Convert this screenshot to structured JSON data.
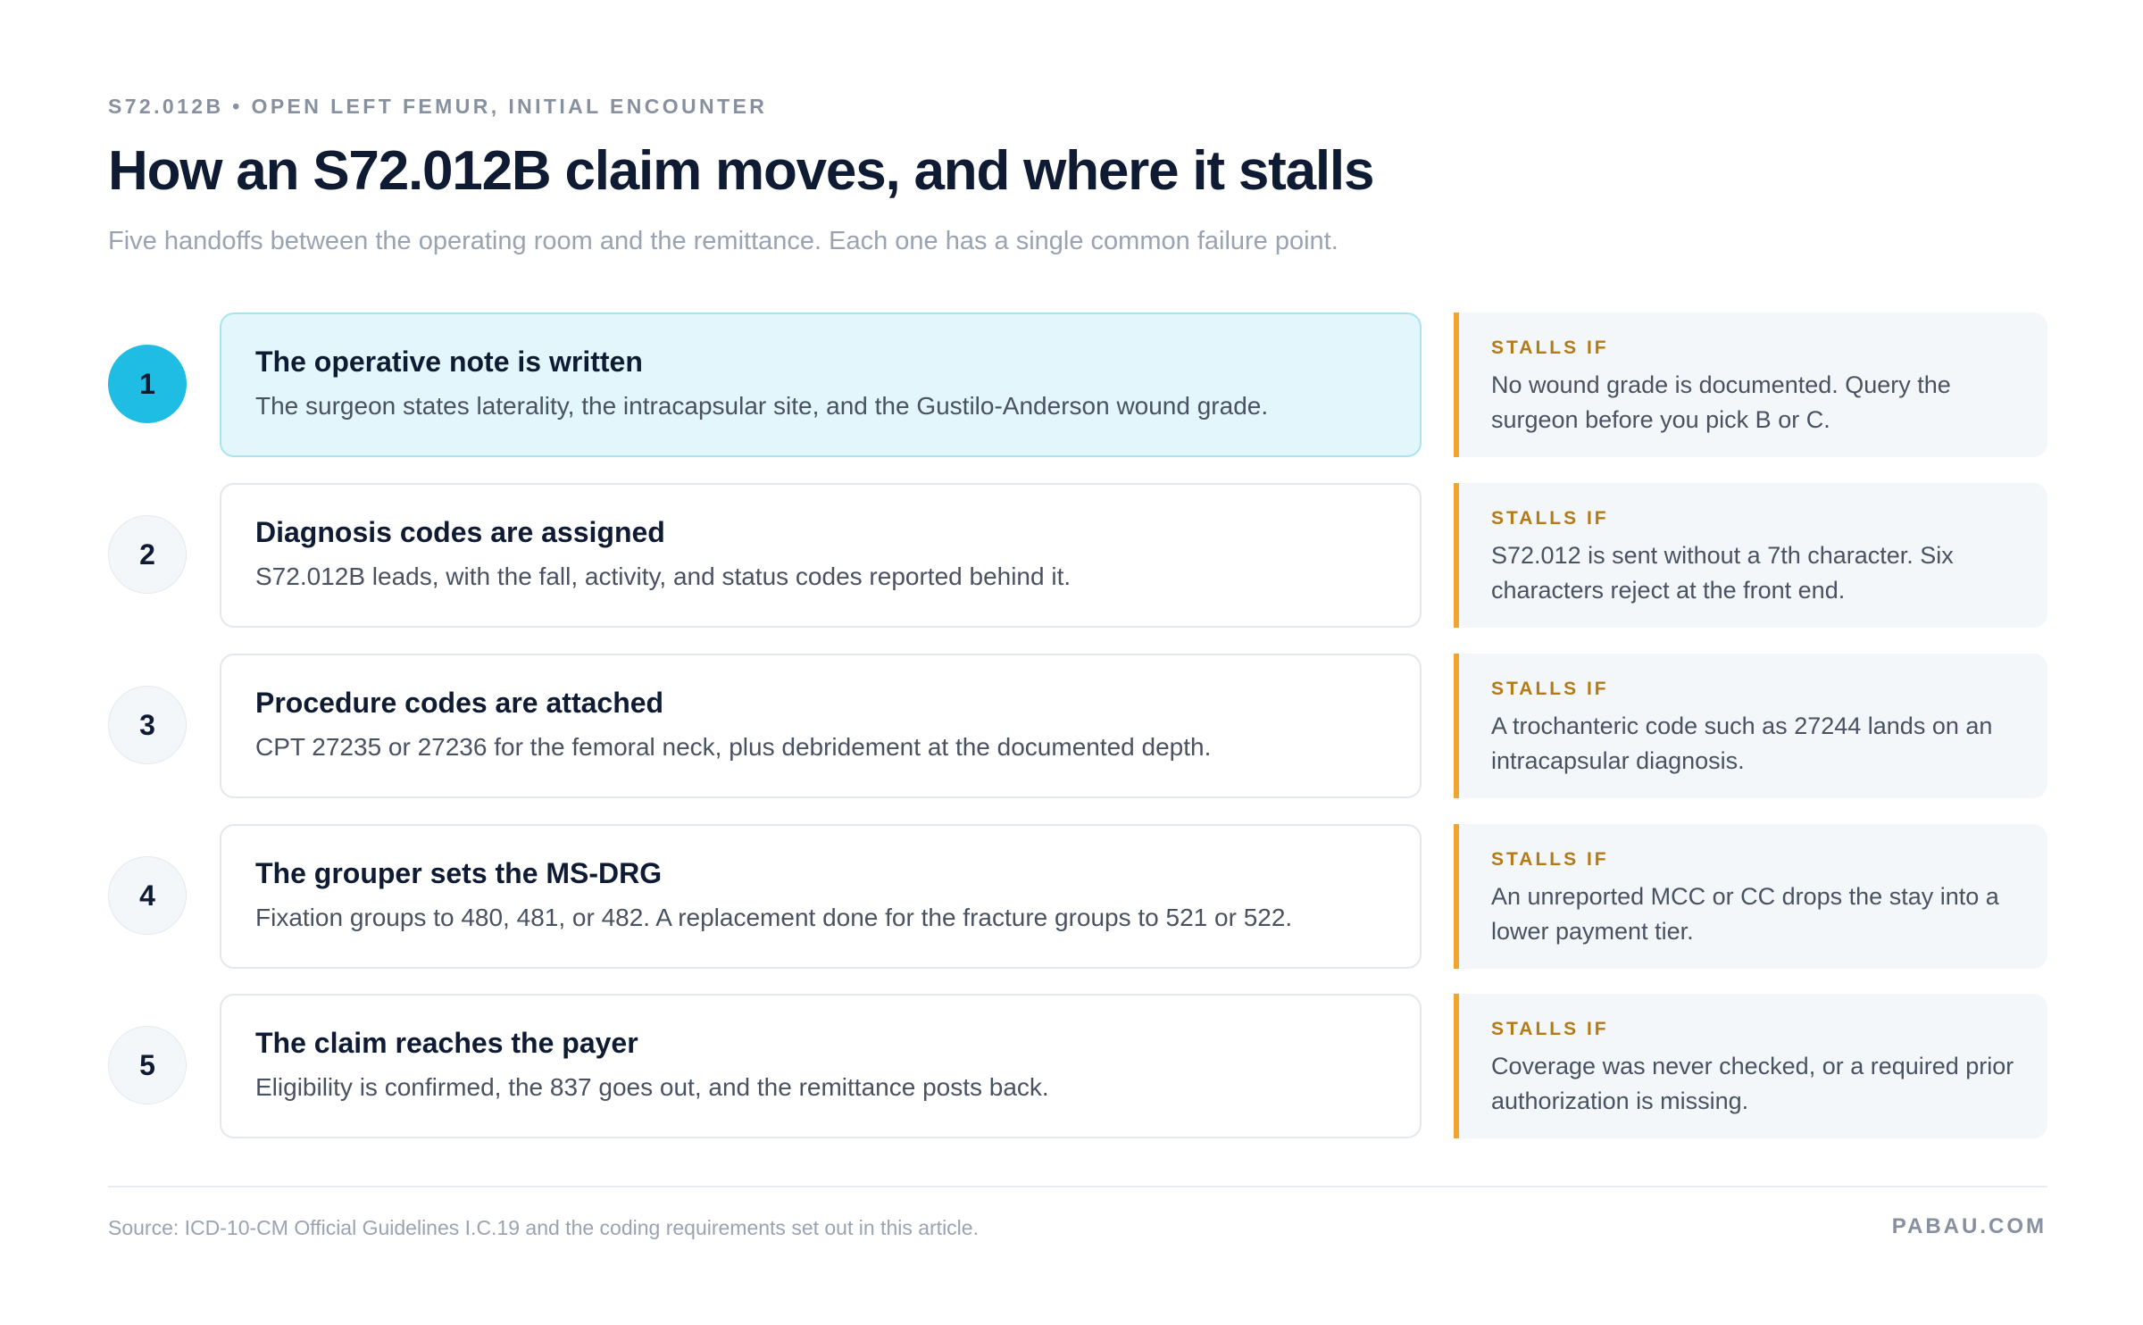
{
  "header": {
    "eyebrow": "S72.012B • OPEN LEFT FEMUR, INITIAL ENCOUNTER",
    "title": "How an S72.012B claim moves, and where it stalls",
    "subtitle": "Five handoffs between the operating room and the remittance. Each one has a single common failure point."
  },
  "steps": [
    {
      "number": "1",
      "title": "The operative note is written",
      "description": "The surgeon states laterality, the intracapsular site, and the Gustilo-Anderson wound grade.",
      "stall_label": "STALLS IF",
      "stall_text": "No wound grade is documented. Query the surgeon before you pick B or C."
    },
    {
      "number": "2",
      "title": "Diagnosis codes are assigned",
      "description": "S72.012B leads, with the fall, activity, and status codes reported behind it.",
      "stall_label": "STALLS IF",
      "stall_text": "S72.012 is sent without a 7th character. Six characters reject at the front end."
    },
    {
      "number": "3",
      "title": "Procedure codes are attached",
      "description": "CPT 27235 or 27236 for the femoral neck, plus debridement at the documented depth.",
      "stall_label": "STALLS IF",
      "stall_text": "A trochanteric code such as 27244 lands on an intracapsular diagnosis."
    },
    {
      "number": "4",
      "title": "The grouper sets the MS-DRG",
      "description": "Fixation groups to 480, 481, or 482. A replacement done for the fracture groups to 521 or 522.",
      "stall_label": "STALLS IF",
      "stall_text": "An unreported MCC or CC drops the stay into a lower payment tier."
    },
    {
      "number": "5",
      "title": "The claim reaches the payer",
      "description": "Eligibility is confirmed, the 837 goes out, and the remittance posts back.",
      "stall_label": "STALLS IF",
      "stall_text": "Coverage was never checked, or a required prior authorization is missing."
    }
  ],
  "footer": {
    "source": "Source: ICD-10-CM Official Guidelines I.C.19 and the coding requirements set out in this article.",
    "brand": "PABAU.COM"
  },
  "colors": {
    "accent": "#1fbde3",
    "active_card": "#e2f6fb",
    "stall_bar": "#f0a62e",
    "stall_label": "#b57a14",
    "title": "#0f1b33"
  }
}
